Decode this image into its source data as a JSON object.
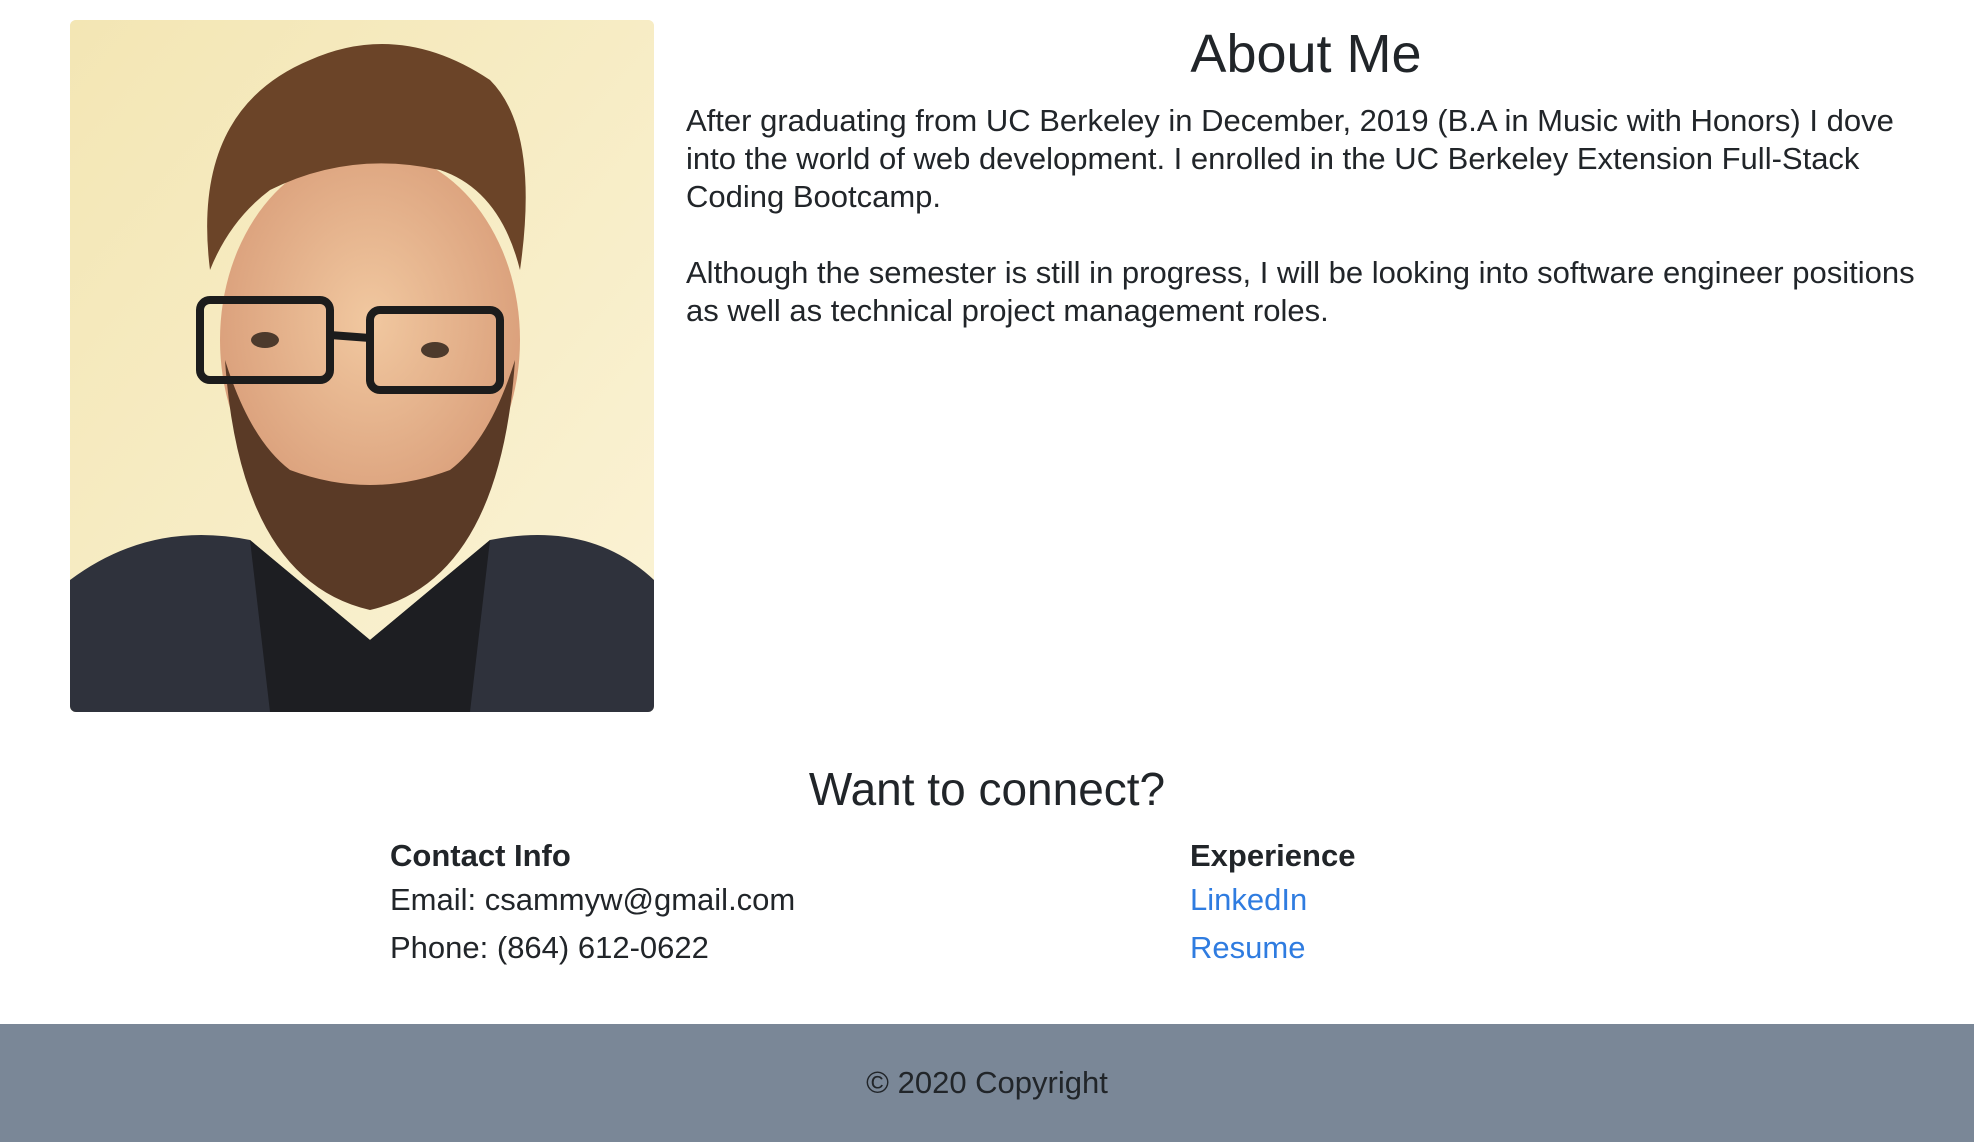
{
  "about": {
    "title": "About Me",
    "paragraphs": [
      "After graduating from UC Berkeley in December, 2019 (B.A in Music with Honors) I dove into the world of web development. I enrolled in the UC Berkeley Extension Full-Stack Coding Bootcamp.",
      "Although the semester is still in progress, I will be looking into software engineer positions as well as technical project management roles."
    ]
  },
  "connect": {
    "title": "Want to connect?",
    "contact": {
      "heading": "Contact Info",
      "email": "Email: csammyw@gmail.com",
      "phone": "Phone: (864) 612-0622"
    },
    "experience": {
      "heading": "Experience",
      "linkedin": "LinkedIn",
      "resume": "Resume"
    }
  },
  "footer": {
    "text": "© 2020 Copyright"
  },
  "colors": {
    "link": "#2f7ce0",
    "footer_bg": "#7a8797",
    "text": "#212529"
  }
}
